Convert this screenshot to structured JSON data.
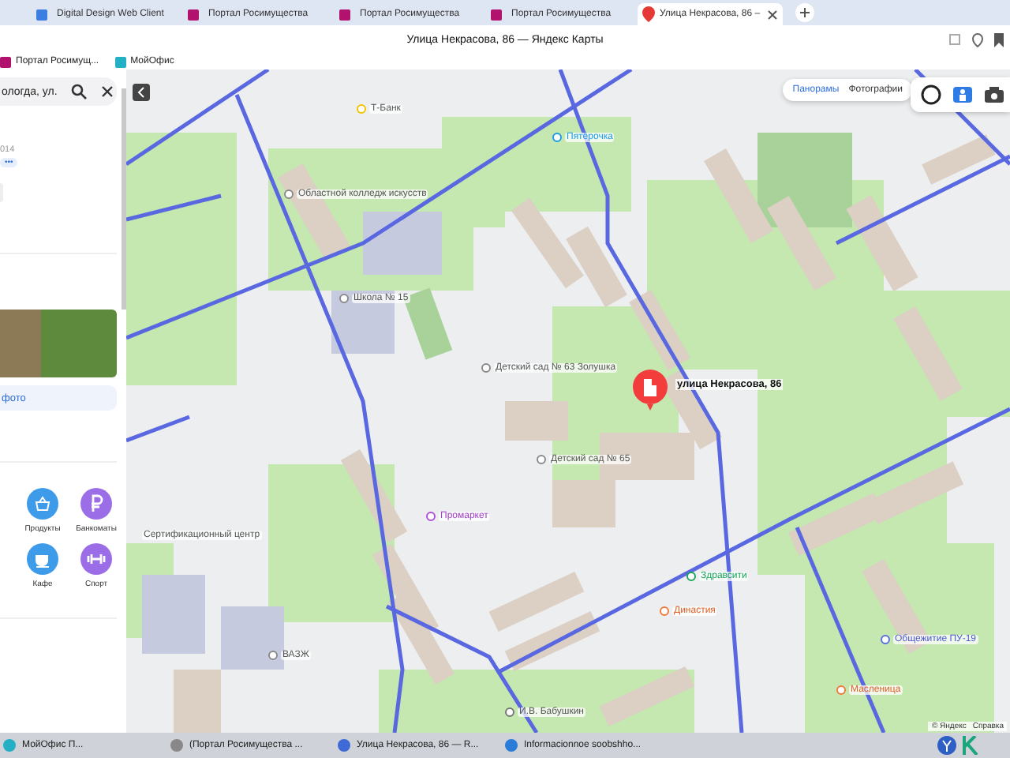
{
  "browser": {
    "tabs": [
      {
        "title": "Digital Design Web Client",
        "kind": "dd",
        "selected": false
      },
      {
        "title": "Портал Росимущества",
        "kind": "portal",
        "selected": false
      },
      {
        "title": "Портал Росимущества",
        "kind": "portal",
        "selected": false
      },
      {
        "title": "Портал Росимущества",
        "kind": "portal",
        "selected": false
      },
      {
        "title": "Улица Некрасова, 86 –",
        "kind": "maps",
        "selected": true
      }
    ],
    "window_title": "Улица Некрасова, 86 — Яндекс Карты",
    "bookmarks": [
      {
        "title": "Портал Росимущ...",
        "kind": "portal"
      },
      {
        "title": "МойОфис",
        "kind": "office"
      }
    ]
  },
  "sidebar": {
    "search": {
      "value": "ологда, ул."
    },
    "info_text": "014",
    "more_badge": "•••",
    "photo_button": "фото",
    "categories": [
      {
        "label": "Продукты",
        "kind": "basket",
        "color": "#3d9be9"
      },
      {
        "label": "Банкоматы",
        "kind": "ruble",
        "color": "#9b6ee8"
      },
      {
        "label": "Кафе",
        "kind": "cup",
        "color": "#3d9be9"
      },
      {
        "label": "Спорт",
        "kind": "dumbbell",
        "color": "#9b6ee8"
      }
    ]
  },
  "map": {
    "modes": [
      {
        "label": "Панорамы",
        "selected": true
      },
      {
        "label": "Фотографии",
        "selected": false
      }
    ],
    "selected_place": "улица Некрасова, 86",
    "places": [
      {
        "name": "Т-Банк",
        "kind": "bank"
      },
      {
        "name": "Пятёрочка",
        "kind": "shop"
      },
      {
        "name": "Областной колледж искусств",
        "kind": "edu"
      },
      {
        "name": "Школа № 15",
        "kind": "edu"
      },
      {
        "name": "Детский сад № 63 Золушка",
        "kind": "edu"
      },
      {
        "name": "Детский сад № 65",
        "kind": "edu"
      },
      {
        "name": "Промаркет",
        "kind": "store"
      },
      {
        "name": "Сертификационный центр",
        "kind": "label"
      },
      {
        "name": "ВАЗЖ",
        "kind": "edu"
      },
      {
        "name": "Здравсити",
        "kind": "pharmacy"
      },
      {
        "name": "Династия",
        "kind": "food"
      },
      {
        "name": "Общежитие ПУ-19",
        "kind": "hostel"
      },
      {
        "name": "Масленица",
        "kind": "food"
      },
      {
        "name": "И.В. Бабушкин",
        "kind": "monument"
      }
    ],
    "attribution": [
      "© Яндекс",
      "Справка"
    ]
  },
  "taskbar": {
    "items": [
      {
        "title": "МойОфис П...",
        "kind": "office"
      },
      {
        "title": "(Портал Росимущества ...",
        "kind": "browser"
      },
      {
        "title": "Улица Некрасова, 86 — R...",
        "kind": "yandex"
      },
      {
        "title": "Informacionnoe soobshho...",
        "kind": "doc"
      }
    ]
  }
}
